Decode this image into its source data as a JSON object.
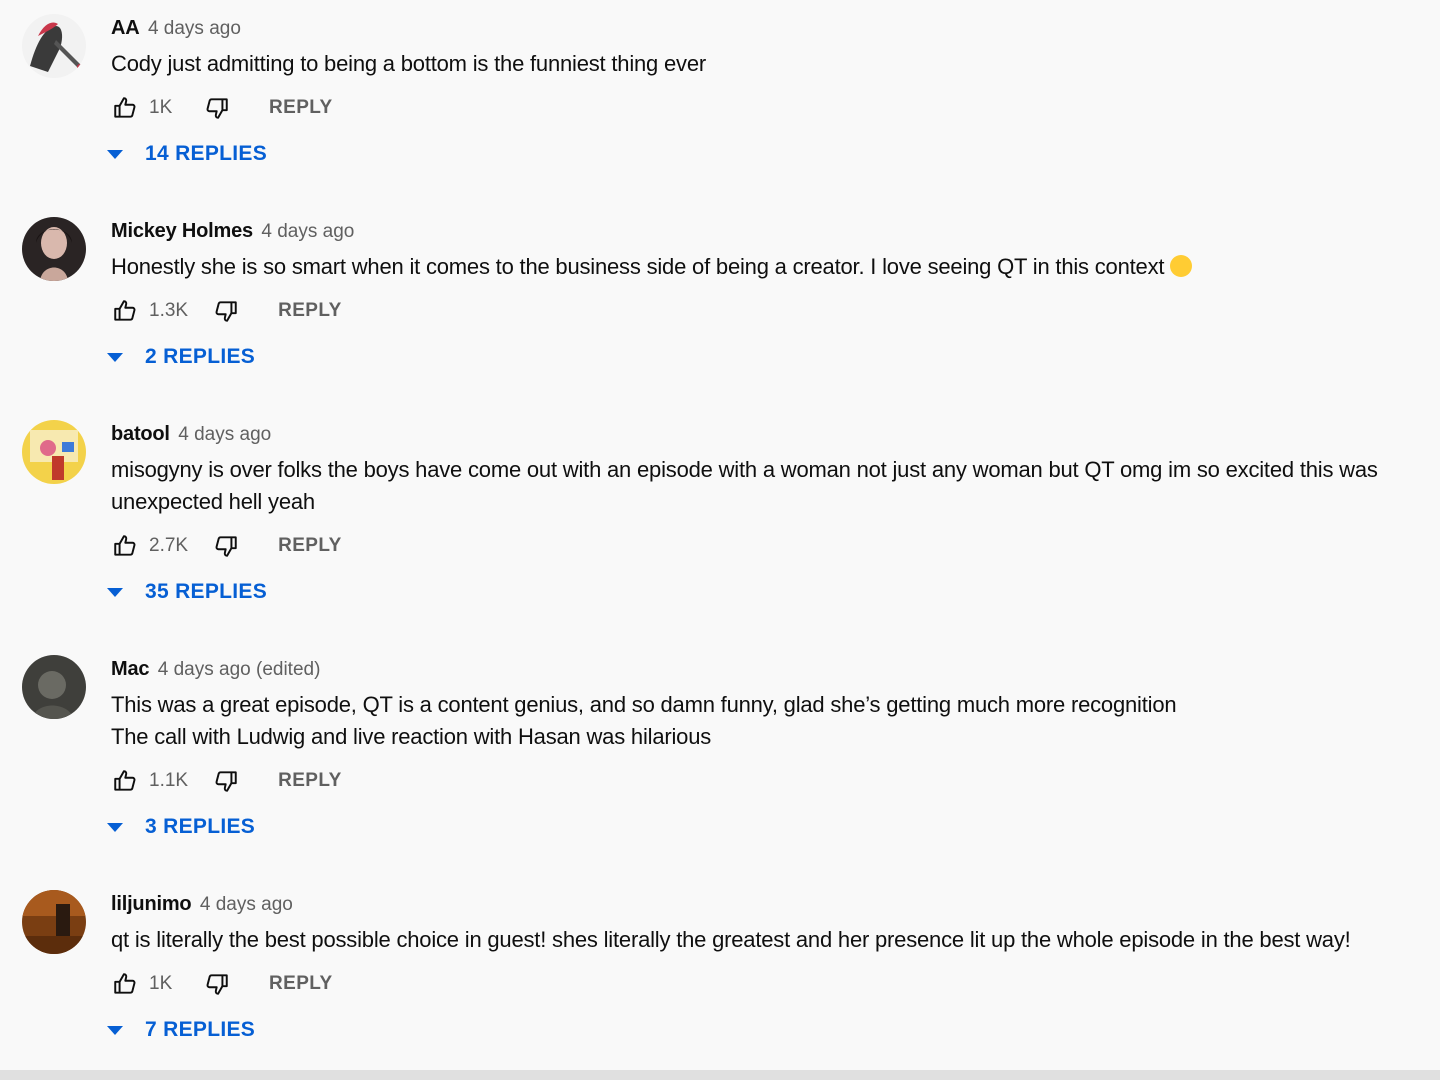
{
  "comments": [
    {
      "author": "AA",
      "time": "4 days ago",
      "lines": [
        "Cody just admitting to being a bottom is the funniest thing ever"
      ],
      "likes": "1K",
      "reply_label": "REPLY",
      "replies_label": "14 REPLIES"
    },
    {
      "author": "Mickey Holmes",
      "time": "4 days ago",
      "lines": [
        "Honestly she is so smart when it comes to the business side of being a creator. I love seeing QT in this context"
      ],
      "likes": "1.3K",
      "reply_label": "REPLY",
      "replies_label": "2 REPLIES"
    },
    {
      "author": "batool",
      "time": "4 days ago",
      "lines": [
        "misogyny is over folks the boys have come out with an episode with a woman not just any woman but QT omg im so excited this was",
        "unexpected hell yeah"
      ],
      "likes": "2.7K",
      "reply_label": "REPLY",
      "replies_label": "35 REPLIES"
    },
    {
      "author": "Mac",
      "time": "4 days ago (edited)",
      "lines": [
        "This was a great episode, QT is a content genius, and so damn funny, glad she’s getting much more recognition",
        "The call with Ludwig and live reaction with Hasan was hilarious"
      ],
      "likes": "1.1K",
      "reply_label": "REPLY",
      "replies_label": "3 REPLIES"
    },
    {
      "author": "liljunimo",
      "time": "4 days ago",
      "lines": [
        "qt is literally the best possible choice in guest! shes literally the greatest and her presence lit up the whole episode in the best way!"
      ],
      "likes": "1K",
      "reply_label": "REPLY",
      "replies_label": "7 REPLIES"
    }
  ],
  "colors": {
    "background": "#f9f9f9",
    "link_blue": "#065fd4",
    "secondary_text": "#606060"
  },
  "icons": [
    "thumbs-up-icon",
    "thumbs-down-icon",
    "caret-down-icon",
    "smiling-emoji-icon"
  ]
}
